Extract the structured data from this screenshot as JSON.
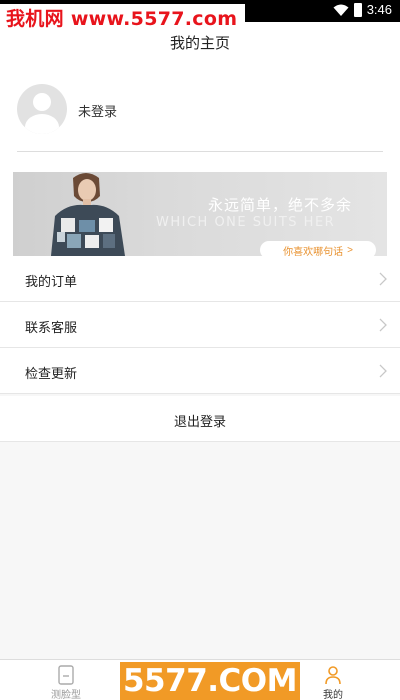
{
  "status_bar": {
    "time": "3:46"
  },
  "watermark": {
    "top_text": "我机网 www.5577.com",
    "bottom_text": "5577.COM"
  },
  "header": {
    "title": "我的主页"
  },
  "profile": {
    "login_status": "未登录"
  },
  "banner": {
    "headline": "永远简单，绝不多余",
    "subline": "WHICH ONE SUITS HER",
    "button_label": "你喜欢哪句话",
    "button_arrow": ">"
  },
  "menu": {
    "items": [
      {
        "label": "我的订单"
      },
      {
        "label": "联系客服"
      },
      {
        "label": "检查更新"
      }
    ],
    "logout_label": "退出登录"
  },
  "bottom_nav": {
    "tabs": [
      {
        "label": "测脸型",
        "icon": "face-shape-icon",
        "active": false
      },
      {
        "label": "我的",
        "icon": "person-icon",
        "active": true
      }
    ]
  },
  "colors": {
    "accent": "#f19a26",
    "watermark_red": "#e8141c"
  }
}
